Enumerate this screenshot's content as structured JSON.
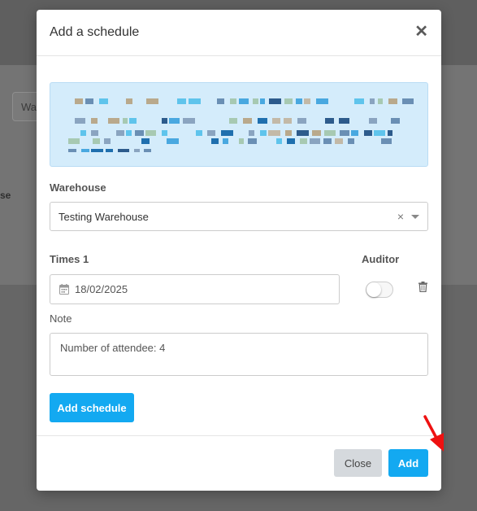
{
  "background": {
    "search_fragment": "Wa",
    "column_fragment": "se"
  },
  "modal": {
    "title": "Add a schedule",
    "close_icon": "close-icon",
    "warehouse_label": "Warehouse",
    "warehouse_value": "Testing Warehouse",
    "times_label": "Times 1",
    "auditor_label": "Auditor",
    "date_value": "18/02/2025",
    "auditor_enabled": false,
    "note_label": "Note",
    "note_value": "Number of attendee: 4",
    "add_schedule_label": "Add schedule",
    "close_label": "Close",
    "add_label": "Add"
  },
  "colors": {
    "primary": "#13a9f1",
    "info_bg": "#d4ecfb",
    "close_btn": "#d5d9dd",
    "annotation_arrow": "#ee1111"
  },
  "icons": [
    "close-icon",
    "calendar-icon",
    "trash-icon",
    "chevron-down-icon",
    "clear-icon"
  ]
}
